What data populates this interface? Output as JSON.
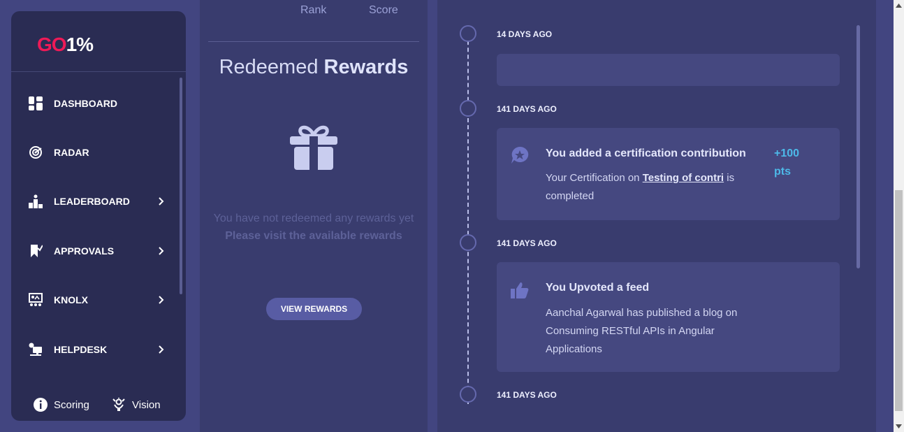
{
  "logo": {
    "part1": "GO",
    "part2": "1%"
  },
  "sidebar": {
    "items": [
      {
        "label": "DASHBOARD",
        "icon": "dashboard-icon"
      },
      {
        "label": "RADAR",
        "icon": "radar-icon"
      },
      {
        "label": "LEADERBOARD",
        "icon": "leaderboard-icon"
      },
      {
        "label": "APPROVALS",
        "icon": "approvals-icon"
      },
      {
        "label": "KNOLX",
        "icon": "knolx-icon"
      },
      {
        "label": "HELPDESK",
        "icon": "helpdesk-icon"
      }
    ],
    "footer": {
      "scoring": "Scoring",
      "vision": "Vision"
    }
  },
  "rewards": {
    "rank_label": "Rank",
    "score_label": "Score",
    "title_light": "Redeemed",
    "title_bold": "Rewards",
    "empty_line1": "You have not redeemed any rewards yet",
    "empty_line2": "Please visit the available rewards",
    "button": "VIEW REWARDS"
  },
  "timeline": {
    "entries": [
      {
        "date": "14 DAYS AGO"
      },
      {
        "date": "141 DAYS AGO",
        "title": "You added a certification contribution",
        "body_prefix": "Your Certification on ",
        "body_link": "Testing of contri",
        "body_suffix": " is completed",
        "points_value": "+100",
        "points_unit": "pts"
      },
      {
        "date": "141 DAYS AGO",
        "title": "You Upvoted a feed",
        "body": "Aanchal Agarwal has published a blog on Consuming RESTful APIs in Angular Applications"
      },
      {
        "date": "141 DAYS AGO"
      }
    ]
  },
  "colors": {
    "accent_pink": "#ee1a57",
    "points_blue": "#4db9e8",
    "sidebar_bg": "#2a2c53",
    "panel_bg": "#393c6e",
    "card_bg": "#454880"
  }
}
